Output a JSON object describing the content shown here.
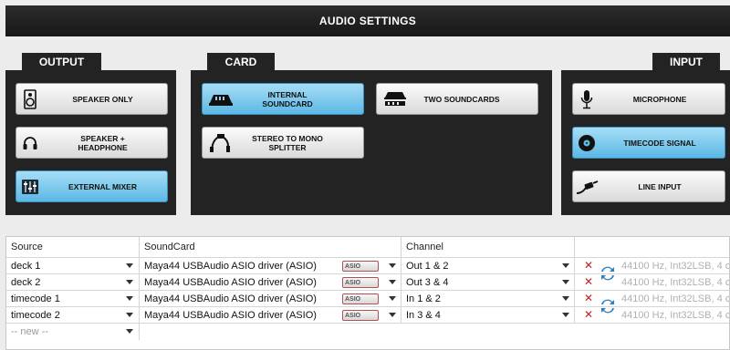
{
  "title": "AUDIO SETTINGS",
  "output": {
    "tab": "OUTPUT",
    "buttons": [
      {
        "label": "SPEAKER ONLY",
        "icon": "speaker-icon",
        "active": false
      },
      {
        "label": "SPEAKER + HEADPHONE",
        "icon": "headphone-icon",
        "active": false
      },
      {
        "label": "EXTERNAL MIXER",
        "icon": "mixer-icon",
        "active": true
      }
    ]
  },
  "card": {
    "tab": "CARD",
    "buttons": [
      {
        "label": "INTERNAL SOUNDCARD",
        "icon": "soundcard-icon",
        "active": true
      },
      {
        "label": "TWO SOUNDCARDS",
        "icon": "two-soundcards-icon",
        "active": false
      },
      {
        "label": "STEREO TO MONO SPLITTER",
        "icon": "splitter-cable-icon",
        "active": false
      }
    ]
  },
  "input": {
    "tab": "INPUT",
    "buttons": [
      {
        "label": "MICROPHONE",
        "icon": "microphone-icon",
        "active": false
      },
      {
        "label": "TIMECODE SIGNAL",
        "icon": "vinyl-icon",
        "active": true
      },
      {
        "label": "LINE INPUT",
        "icon": "line-cable-icon",
        "active": false
      }
    ]
  },
  "table": {
    "headers": [
      "Source",
      "SoundCard",
      "Channel"
    ],
    "asio_label": "ASIO",
    "rows": [
      {
        "source": "deck 1",
        "soundcard": "Maya44 USBAudio ASIO driver (ASIO)",
        "channel": "Out 1 & 2",
        "info": "44100 Hz, Int32LSB, 4 c"
      },
      {
        "source": "deck 2",
        "soundcard": "Maya44 USBAudio ASIO driver (ASIO)",
        "channel": "Out 3 & 4",
        "info": "44100 Hz, Int32LSB, 4 c"
      },
      {
        "source": "timecode 1",
        "soundcard": "Maya44 USBAudio ASIO driver (ASIO)",
        "channel": "In 1 & 2",
        "info": "44100 Hz, Int32LSB, 4 c"
      },
      {
        "source": "timecode 2",
        "soundcard": "Maya44 USBAudio ASIO driver (ASIO)",
        "channel": "In 3 & 4",
        "info": "44100 Hz, Int32LSB, 4 c"
      }
    ],
    "new_row": "-- new --"
  },
  "colors": {
    "active_button": "#5cb8e6",
    "panel": "#232323",
    "delete": "#c42020"
  }
}
